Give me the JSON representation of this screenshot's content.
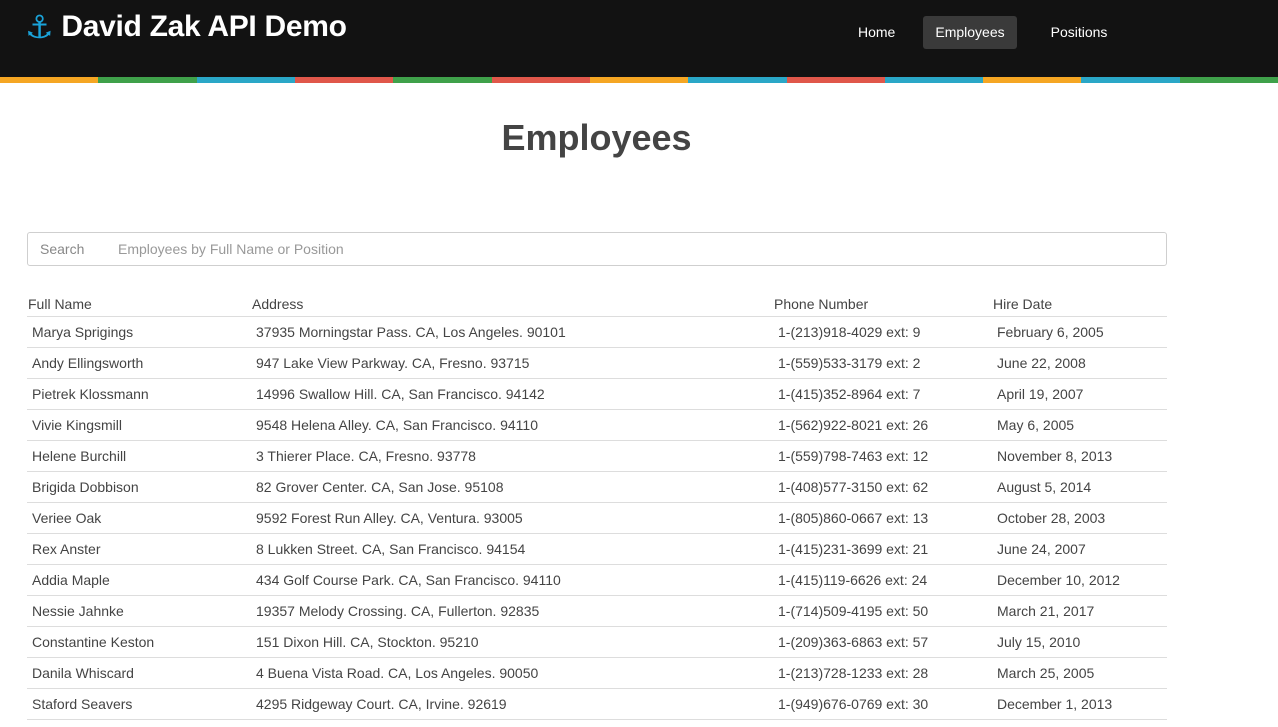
{
  "header": {
    "brand": "David Zak API Demo",
    "nav": [
      {
        "label": "Home"
      },
      {
        "label": "Employees"
      },
      {
        "label": "Positions"
      }
    ]
  },
  "colorbar": [
    "#f5a623",
    "#3fa14a",
    "#2aa7c7",
    "#e0574a",
    "#3fa14a",
    "#e0574a",
    "#f5a623",
    "#2aa7c7",
    "#e0574a",
    "#2aa7c7",
    "#f5a623",
    "#2aa7c7",
    "#3fa14a"
  ],
  "page_title": "Employees",
  "search": {
    "label": "Search",
    "placeholder": "Employees by Full Name or Position",
    "value": ""
  },
  "table": {
    "headers": [
      "Full Name",
      "Address",
      "Phone Number",
      "Hire Date"
    ],
    "rows": [
      [
        "Marya Sprigings",
        "37935 Morningstar Pass. CA, Los Angeles. 90101",
        "1-(213)918-4029 ext: 9",
        "February 6, 2005"
      ],
      [
        "Andy Ellingsworth",
        "947 Lake View Parkway. CA, Fresno. 93715",
        "1-(559)533-3179 ext: 2",
        "June 22, 2008"
      ],
      [
        "Pietrek Klossmann",
        "14996 Swallow Hill. CA, San Francisco. 94142",
        "1-(415)352-8964 ext: 7",
        "April 19, 2007"
      ],
      [
        "Vivie Kingsmill",
        "9548 Helena Alley. CA, San Francisco. 94110",
        "1-(562)922-8021 ext: 26",
        "May 6, 2005"
      ],
      [
        "Helene Burchill",
        "3 Thierer Place. CA, Fresno. 93778",
        "1-(559)798-7463 ext: 12",
        "November 8, 2013"
      ],
      [
        "Brigida Dobbison",
        "82 Grover Center. CA, San Jose. 95108",
        "1-(408)577-3150 ext: 62",
        "August 5, 2014"
      ],
      [
        "Veriee Oak",
        "9592 Forest Run Alley. CA, Ventura. 93005",
        "1-(805)860-0667 ext: 13",
        "October 28, 2003"
      ],
      [
        "Rex Anster",
        "8 Lukken Street. CA, San Francisco. 94154",
        "1-(415)231-3699 ext: 21",
        "June 24, 2007"
      ],
      [
        "Addia Maple",
        "434 Golf Course Park. CA, San Francisco. 94110",
        "1-(415)119-6626 ext: 24",
        "December 10, 2012"
      ],
      [
        "Nessie Jahnke",
        "19357 Melody Crossing. CA, Fullerton. 92835",
        "1-(714)509-4195 ext: 50",
        "March 21, 2017"
      ],
      [
        "Constantine Keston",
        "151 Dixon Hill. CA, Stockton. 95210",
        "1-(209)363-6863 ext: 57",
        "July 15, 2010"
      ],
      [
        "Danila Whiscard",
        "4 Buena Vista Road. CA, Los Angeles. 90050",
        "1-(213)728-1233 ext: 28",
        "March 25, 2005"
      ],
      [
        "Staford Seavers",
        "4295 Ridgeway Court. CA, Irvine. 92619",
        "1-(949)676-0769 ext: 30",
        "December 1, 2013"
      ]
    ]
  }
}
